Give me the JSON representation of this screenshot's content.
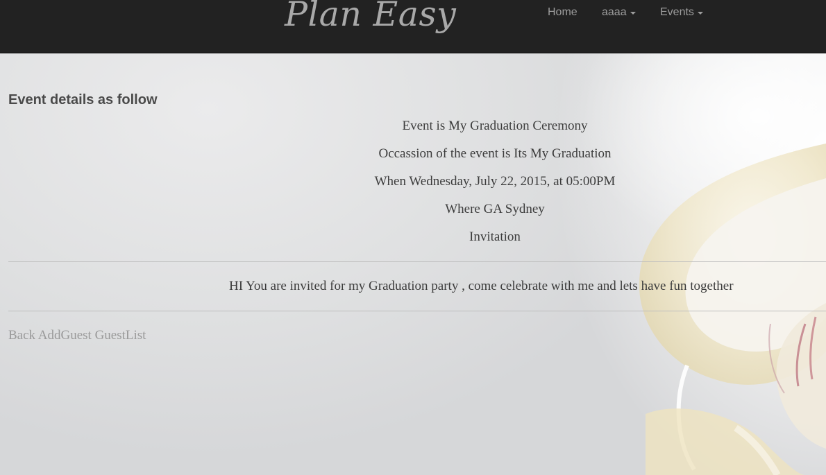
{
  "navbar": {
    "brand": "Plan Easy",
    "items": [
      {
        "label": "Home",
        "dropdown": false
      },
      {
        "label": "aaaa",
        "dropdown": true
      },
      {
        "label": "Events",
        "dropdown": true
      }
    ]
  },
  "main": {
    "heading": "Event details as follow",
    "details": [
      "Event is My Graduation Ceremony",
      "Occassion of the event is Its My Graduation",
      "When Wednesday, July 22, 2015, at 05:00PM",
      "Where GA Sydney",
      "Invitation"
    ],
    "message": "HI You are invited for my Graduation party , come celebrate with me and lets have fun together",
    "links": [
      "Back",
      "AddGuest",
      "GuestList"
    ]
  },
  "colors": {
    "navbar_bg": "#222222",
    "nav_text": "#9d9d9d",
    "body_text": "#3c3c3c",
    "link_text": "#9a9a9a"
  }
}
